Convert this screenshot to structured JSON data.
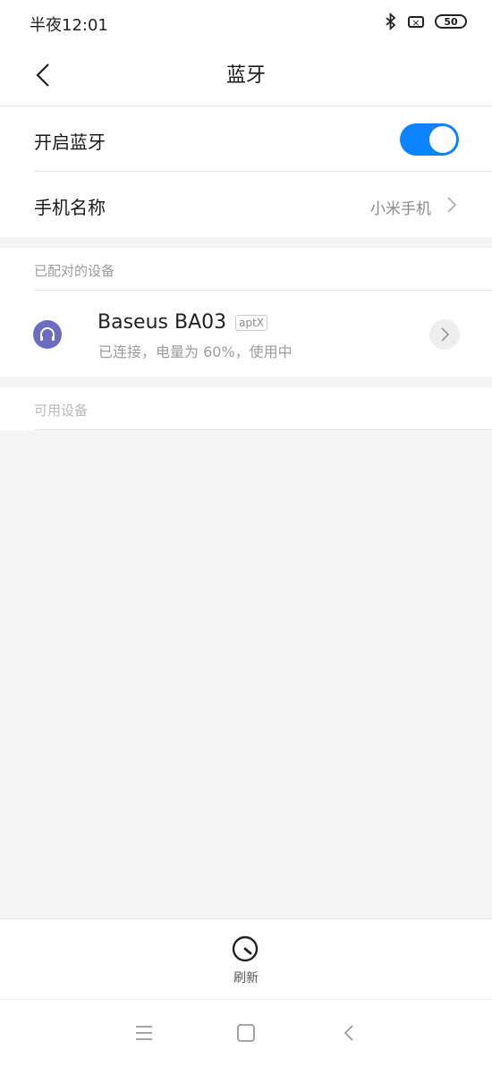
{
  "status_bar": {
    "time": "半夜12:01",
    "sim_icon_text": "×",
    "battery": "50",
    "icons": [
      "bluetooth-icon",
      "no-sim-icon",
      "battery-icon"
    ]
  },
  "header": {
    "title": "蓝牙",
    "back_icon": "back-chevron-icon"
  },
  "settings": {
    "bluetooth_toggle_label": "开启蓝牙",
    "bluetooth_enabled": true,
    "phone_name_label": "手机名称",
    "phone_name_value": "小米手机"
  },
  "paired_section": {
    "heading": "已配对的设备",
    "devices": [
      {
        "name": "Baseus BA03",
        "codec_tag": "aptX",
        "status": "已连接，电量为 60%，使用中",
        "icon": "headset-icon"
      }
    ]
  },
  "available_section": {
    "heading": "可用设备"
  },
  "bottom_action": {
    "label": "刷新",
    "icon": "refresh-icon"
  },
  "colors": {
    "accent": "#0d84ff",
    "device_icon_bg": "#6b6dc0"
  }
}
